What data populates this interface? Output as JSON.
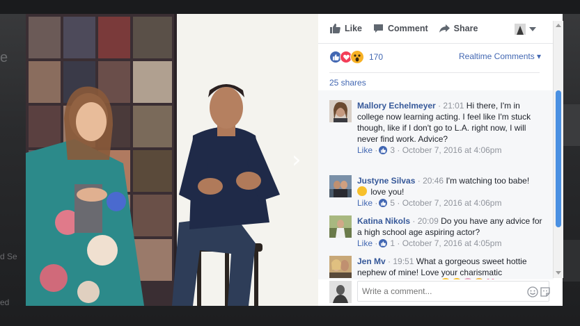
{
  "backdrop": {
    "side_text_1": "e",
    "side_text_2": "d Se",
    "side_text_3": "ed"
  },
  "video": {
    "next_glyph": "›"
  },
  "actions": {
    "like": "Like",
    "comment": "Comment",
    "share": "Share"
  },
  "reactions": {
    "count": "170",
    "realtime_label": "Realtime Comments ▾"
  },
  "shares_label": "25 shares",
  "comments": [
    {
      "name": "Mallory Echelmeyer",
      "time": "21:01",
      "text": "Hi there, I'm in college now learning acting. I feel like I'm stuck though, like if I don't go to L.A. right now, I will never find work. Advice?",
      "like_label": "Like",
      "likes": "3",
      "date": "October 7, 2016 at 4:06pm",
      "avatar_color": "#8a6a55"
    },
    {
      "name": "Justyne Silvas",
      "time": "20:46",
      "text": "I'm watching too babe!",
      "text2": "love you!",
      "like_label": "Like",
      "likes": "5",
      "date": "October 7, 2016 at 4:06pm",
      "avatar_color": "#5a7086"
    },
    {
      "name": "Katina Nikols",
      "time": "20:09",
      "text": "Do you have any advice for a high school age aspiring actor?",
      "like_label": "Like",
      "likes": "1",
      "date": "October 7, 2016 at 4:05pm",
      "avatar_color": "#8fa06a"
    },
    {
      "name": "Jen Mv",
      "time": "19:51",
      "text": "What a gorgeous sweet hottie nephew of mine! Love your charismatic personality! So lovely!",
      "avatar_color": "#b08a55"
    }
  ],
  "compose": {
    "placeholder": "Write a comment..."
  },
  "colors": {
    "link": "#4267b2",
    "name": "#365899",
    "meta": "#90949c",
    "scroll_thumb": "#4a90e2"
  },
  "icons": [
    "like-thumb-icon",
    "comment-bubble-icon",
    "share-arrow-icon",
    "chevron-down-icon",
    "emoji-smile-icon",
    "sticker-icon",
    "next-arrow-icon"
  ]
}
